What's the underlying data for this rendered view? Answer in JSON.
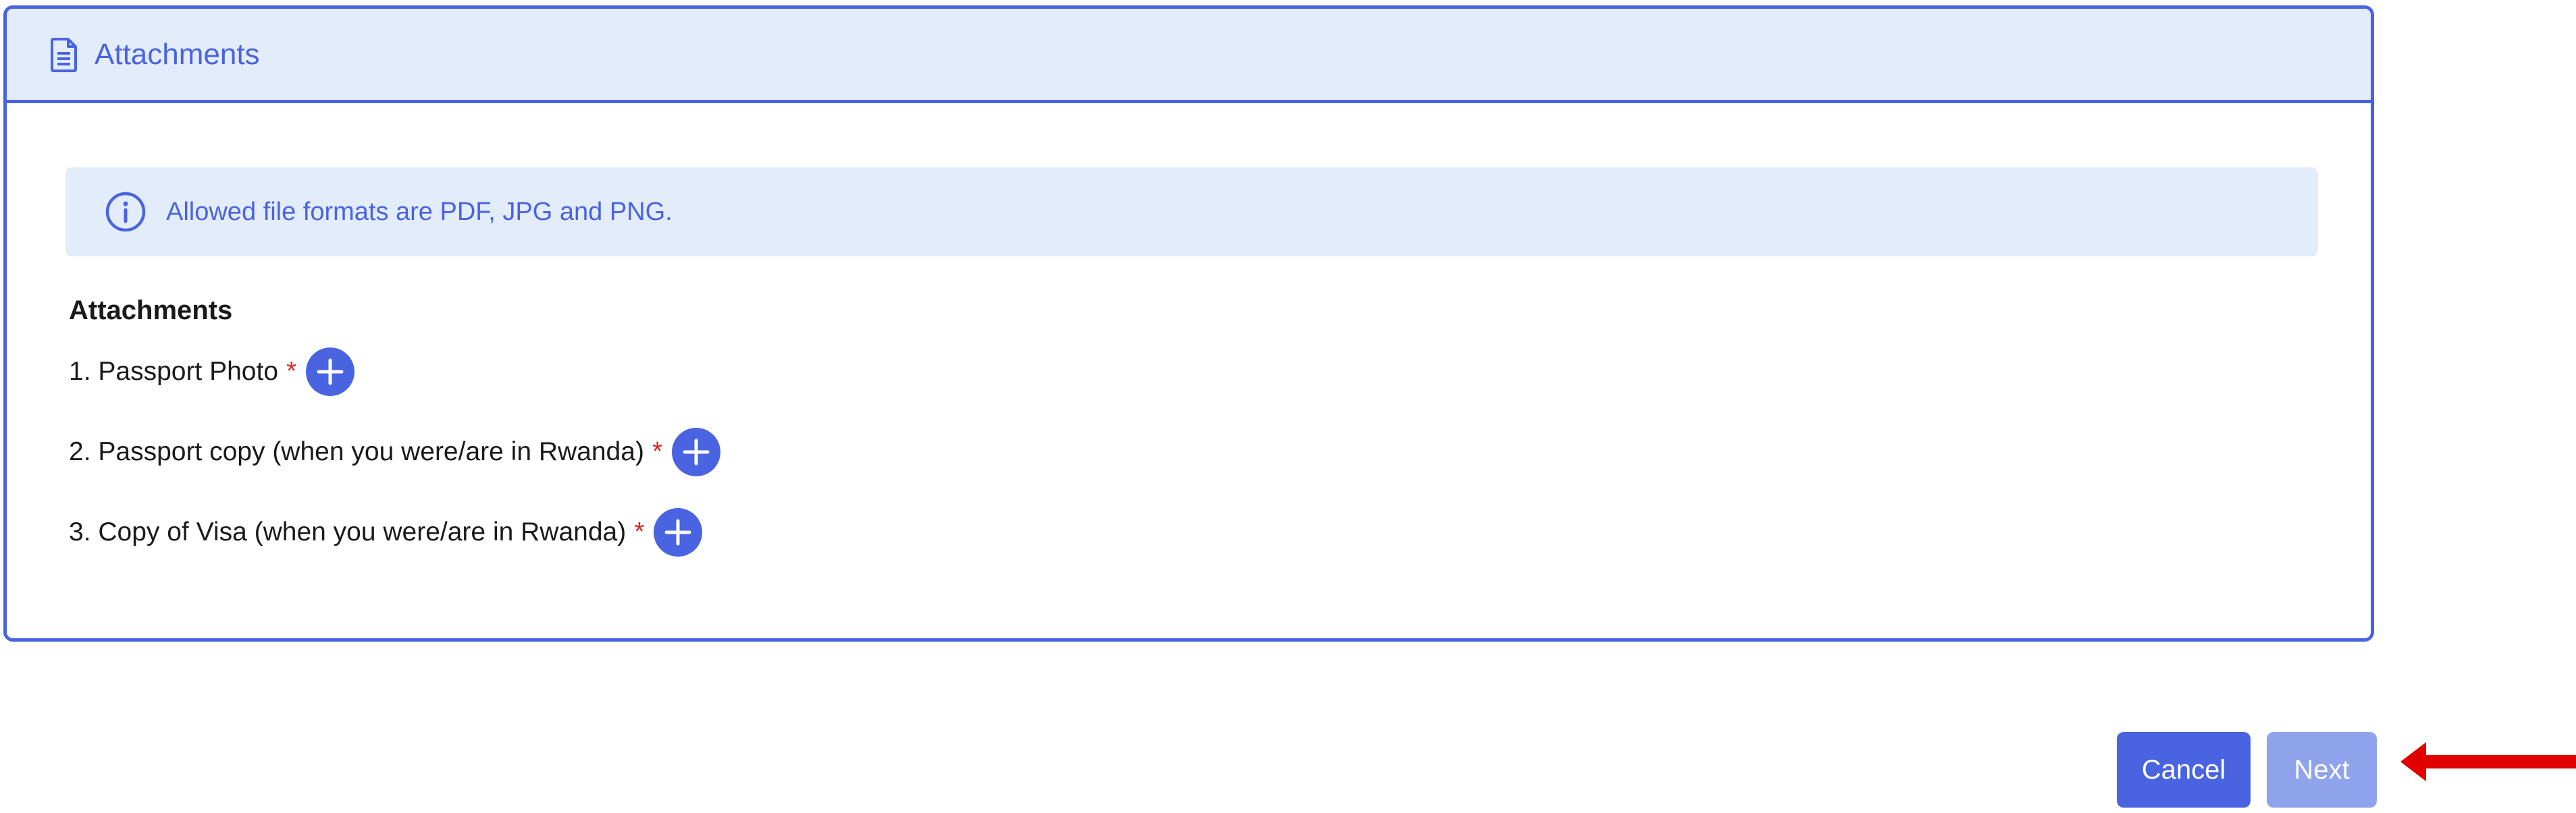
{
  "panel": {
    "title": "Attachments",
    "icon": "document-icon"
  },
  "info": {
    "icon": "info-icon",
    "text": "Allowed file formats are PDF, JPG and PNG."
  },
  "attachments": {
    "heading": "Attachments",
    "required_marker": "*",
    "items": [
      {
        "label": "1. Passport Photo"
      },
      {
        "label": "2. Passport copy (when you were/are in Rwanda)"
      },
      {
        "label": "3. Copy of Visa (when you were/are in Rwanda)"
      }
    ]
  },
  "actions": {
    "cancel_label": "Cancel",
    "next_label": "Next"
  },
  "colors": {
    "accent": "#4a63e0",
    "header_bg": "#e3ecfb",
    "next_disabled": "#8fa2ec",
    "required": "#e02424",
    "annotation_arrow": "#e00000"
  }
}
